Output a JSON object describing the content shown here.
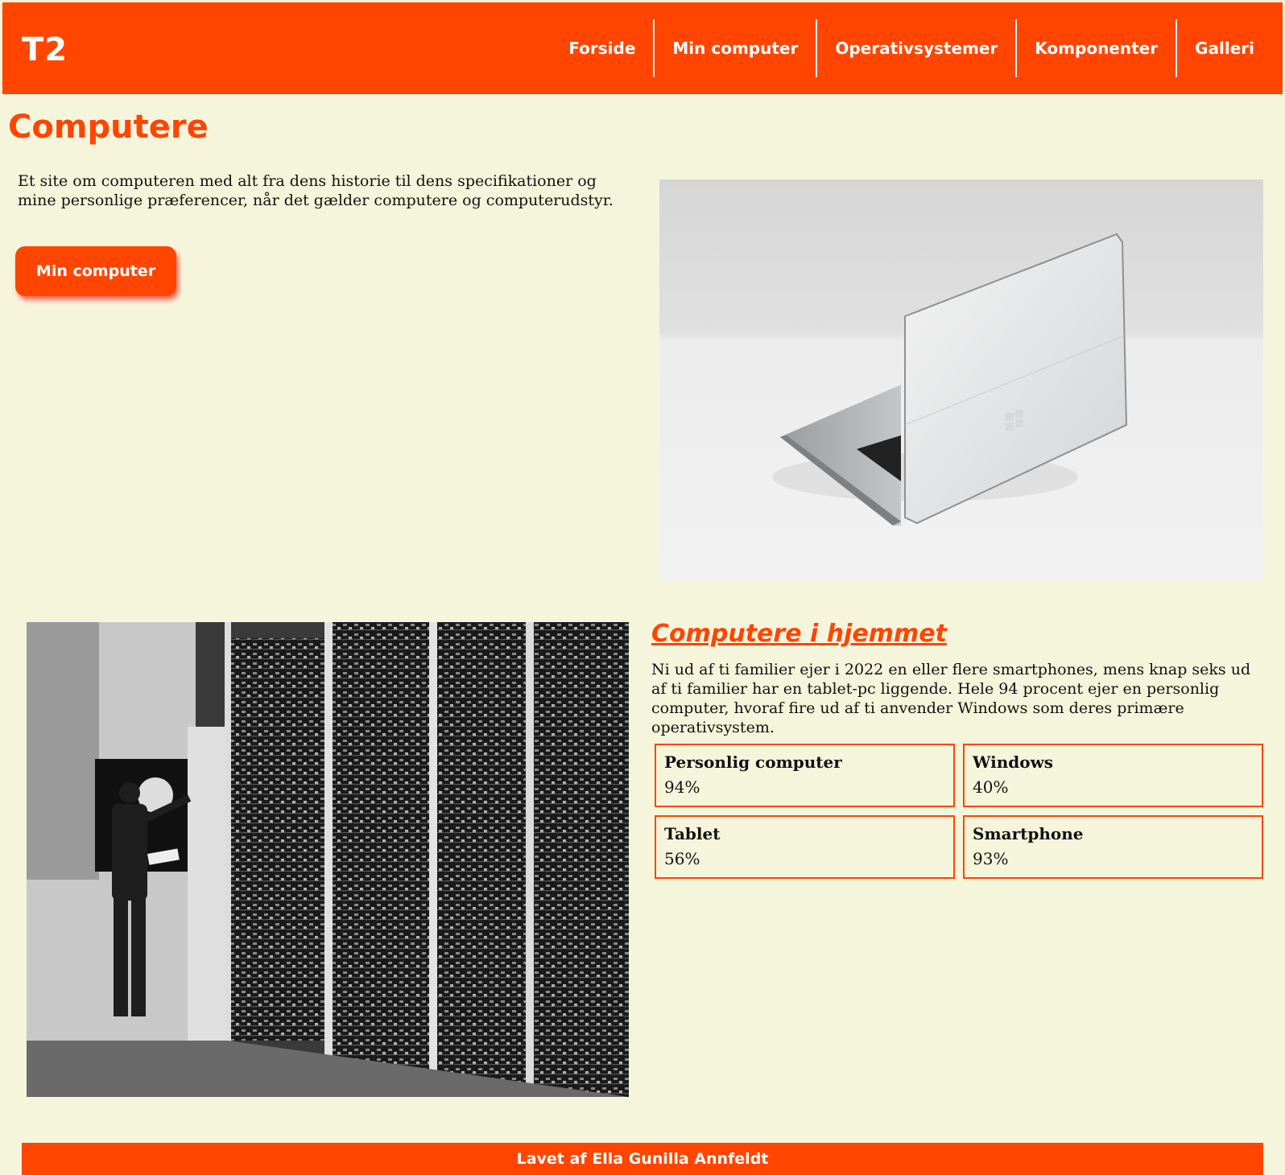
{
  "header": {
    "logo": "T2",
    "nav": [
      "Forside",
      "Min computer",
      "Operativsystemer",
      "Komponenter",
      "Galleri"
    ]
  },
  "hero": {
    "title": "Computere",
    "intro": "Et site om computeren med alt fra dens historie til dens specifikationer og mine personlige præferencer, når det gælder computere og computerudstyr.",
    "button_label": "Min computer"
  },
  "section": {
    "title": "Computere i hjemmet",
    "text": "Ni ud af ti familier ejer i 2022 en eller flere smartphones, mens knap seks ud af ti familier har en tablet-pc liggende. Hele 94 procent ejer en personlig computer, hvoraf fire ud af ti anvender Windows som deres primære operativsystem.",
    "stats": [
      {
        "label": "Personlig computer",
        "value": "94%"
      },
      {
        "label": "Windows",
        "value": "40%"
      },
      {
        "label": "Tablet",
        "value": "56%"
      },
      {
        "label": "Smartphone",
        "value": "93%"
      }
    ]
  },
  "footer": {
    "text": "Lavet af Ella Gunilla Annfeldt"
  },
  "colors": {
    "accent": "#ff4500",
    "background": "#f5f5dc"
  }
}
